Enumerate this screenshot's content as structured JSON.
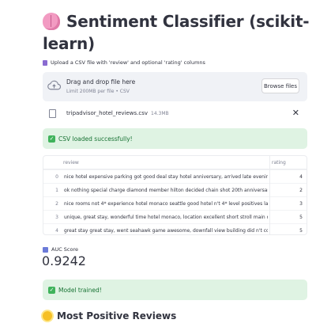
{
  "header": {
    "title": "Sentiment Classifier (scikit-learn)",
    "title_icon": "brain-emoji-icon"
  },
  "uploader": {
    "label": "Upload a CSV file with 'review' and optional 'rating' columns",
    "drop_title": "Drag and drop file here",
    "limit_text": "Limit 200MB per file • CSV",
    "browse_label": "Browse files",
    "file_name": "tripadvisor_hotel_reviews.csv",
    "file_size": "14.3MB",
    "close_glyph": "✕"
  },
  "alerts": {
    "csv_loaded": "CSV loaded successfully!",
    "model_trained": "Model trained!",
    "check_glyph": "✓"
  },
  "table": {
    "columns": [
      "",
      "review",
      "rating"
    ],
    "rows": [
      {
        "index": "0",
        "review": "nice hotel expensive parking got good deal stay hotel anniversary, arrived late evening took ac",
        "rating": "4"
      },
      {
        "index": "1",
        "review": "ok nothing special charge diamond member hilton decided chain shot 20th anniversary seattl",
        "rating": "2"
      },
      {
        "index": "2",
        "review": "nice rooms not 4* experience hotel monaco seattle good hotel n't 4* level positives large bath",
        "rating": "3"
      },
      {
        "index": "3",
        "review": "unique, great stay, wonderful time hotel monaco, location excellent short stroll main downtov",
        "rating": "5"
      },
      {
        "index": "4",
        "review": "great stay great stay, went seahawk game awesome, downfall view building did n't complain,",
        "rating": "5"
      }
    ]
  },
  "metric": {
    "label": "AUC Score",
    "value": "0.9242"
  },
  "section": {
    "title": "Most Positive Reviews",
    "icon": "sun-emoji-icon"
  },
  "colors": {
    "accent_green": "#177233",
    "alert_bg": "#dff3e3",
    "dropzone_bg": "#f0f2f6"
  }
}
